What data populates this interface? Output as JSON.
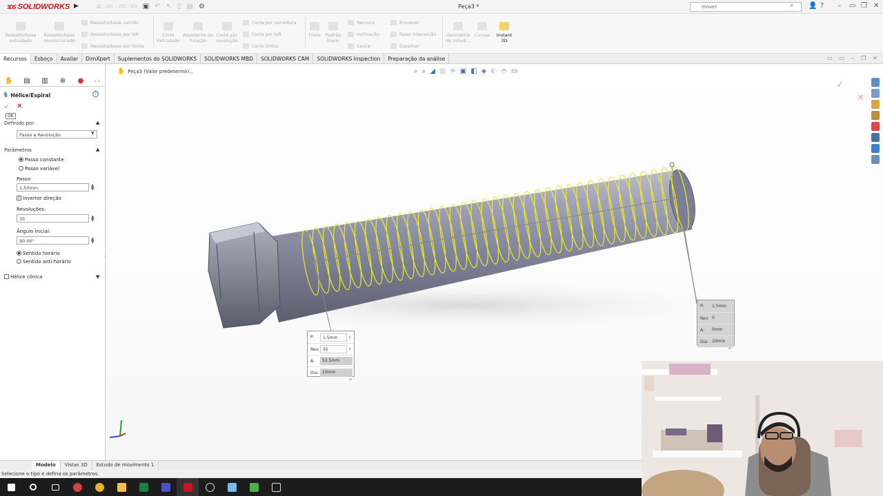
{
  "app": {
    "logo": "SOLIDWORKS",
    "title": "Peça3 *"
  },
  "search": {
    "value": "mover"
  },
  "ribbon": {
    "buttons": [
      {
        "label": "Ressalto/base extrudado"
      },
      {
        "label": "Ressalto/base revolucionado"
      },
      {
        "label": "Corte extrudado"
      },
      {
        "label": "Assistente de furação"
      },
      {
        "label": "Corte por revolução"
      },
      {
        "label": "Filete"
      },
      {
        "label": "Padrão linear"
      },
      {
        "label": "Geometria de referê..."
      },
      {
        "label": "Curvas"
      },
      {
        "label": "Instant 3D"
      }
    ],
    "small": [
      {
        "label": "Ressalto/base varrido"
      },
      {
        "label": "Ressalto/base por loft"
      },
      {
        "label": "Ressalto/base por limite"
      },
      {
        "label": "Corte por varredura"
      },
      {
        "label": "Corte por loft"
      },
      {
        "label": "Corte limite"
      },
      {
        "label": "Nervura"
      },
      {
        "label": "Inclinação"
      },
      {
        "label": "Casca"
      },
      {
        "label": "Envolver"
      },
      {
        "label": "Fazer interseção"
      },
      {
        "label": "Espelhar"
      }
    ]
  },
  "command_tabs": [
    "Recursos",
    "Esboço",
    "Avaliar",
    "DimXpert",
    "Suplementos do SOLIDWORKS",
    "SOLIDWORKS MBD",
    "SOLIDWORKS CAM",
    "SOLIDWORKS Inspection",
    "Preparação da análise"
  ],
  "panel": {
    "title": "Hélice/Espiral",
    "ok_tooltip": "OK",
    "defined_by_label": "Definido por:",
    "defined_by_value": "Passo e Revolução",
    "params_header": "Parâmetros",
    "pitch_constant": "Passo constante",
    "pitch_variable": "Passo variável",
    "pitch_label": "Passo:",
    "pitch_value": "1.50mm",
    "reverse_label": "Inverter direção",
    "revolutions_label": "Revoluções:",
    "revolutions_value": "35",
    "start_angle_label": "Ângulo inicial:",
    "start_angle_value": "90.00°",
    "clockwise": "Sentido horário",
    "counterclockwise": "Sentido anti-horário",
    "tapered": "Hélice cônica"
  },
  "breadcrumb": "Peça3 (Valor predetermin...",
  "callout_main": {
    "p_key": "P:",
    "p_val": "1.5mm",
    "rev_key": "Rev:",
    "rev_val": "35",
    "a_key": "A:",
    "a_val": "52.5mm",
    "dia_key": "Dia:",
    "dia_val": "10mm"
  },
  "callout_end": {
    "p_key": "P:",
    "p_val": "1.5mm",
    "rev_key": "Rev:",
    "rev_val": "0",
    "a_key": "A:",
    "a_val": "0mm",
    "dia_key": "Dia:",
    "dia_val": "10mm"
  },
  "bottom_tabs": [
    "Modelo",
    "Vistas 3D",
    "Estudo de movimento 1"
  ],
  "status": "Selecione o tipo e defina os parâmetros."
}
